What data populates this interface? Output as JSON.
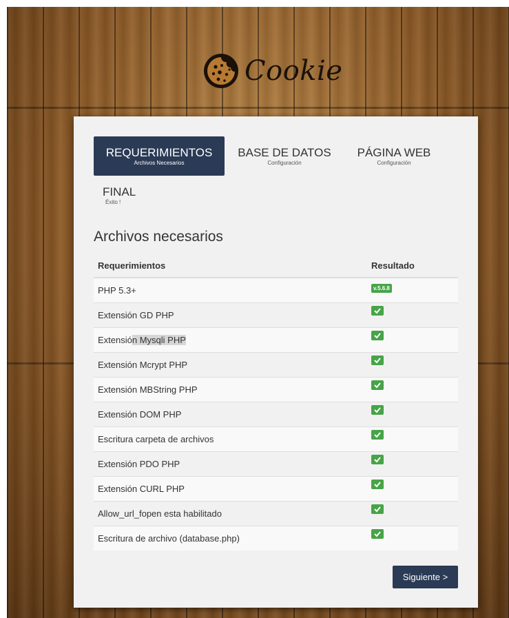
{
  "app": {
    "brand": "Cookie",
    "logo_icon": "cookie-icon"
  },
  "steps": [
    {
      "title": "REQUERIMIENTOS",
      "subtitle": "Archivos Necesarios",
      "active": true
    },
    {
      "title": "BASE DE DATOS",
      "subtitle": "Configuración",
      "active": false
    },
    {
      "title": "PÁGINA WEB",
      "subtitle": "Configuración",
      "active": false
    },
    {
      "title": "FINAL",
      "subtitle": "Éxito !",
      "active": false
    }
  ],
  "section_title": "Archivos necesarios",
  "table": {
    "headers": [
      "Requerimientos",
      "Resultado"
    ],
    "rows": [
      {
        "requirement": "PHP 5.3+",
        "result": "v.5.6.8"
      },
      {
        "requirement": "Extensión GD PHP",
        "result": "check-icon"
      },
      {
        "requirement_a": "Extensió",
        "requirement_b": "n Mysqli PHP",
        "result": "check-icon"
      },
      {
        "requirement": "Extensión Mcrypt PHP",
        "result": "check-icon"
      },
      {
        "requirement": "Extensión MBString PHP",
        "result": "check-icon"
      },
      {
        "requirement": "Extensión DOM PHP",
        "result": "check-icon"
      },
      {
        "requirement": "Escritura carpeta de archivos",
        "result": "check-icon"
      },
      {
        "requirement": "Extensión PDO PHP",
        "result": "check-icon"
      },
      {
        "requirement": "Extensión CURL PHP",
        "result": "check-icon"
      },
      {
        "requirement": "Allow_url_fopen esta habilitado",
        "result": "check-icon"
      },
      {
        "requirement": "Escritura de archivo (database.php)",
        "result": "check-icon"
      }
    ]
  },
  "next_button": "Siguiente >",
  "colors": {
    "primary": "#2b3a55",
    "success": "#47a447",
    "card": "#f1f1f1"
  }
}
